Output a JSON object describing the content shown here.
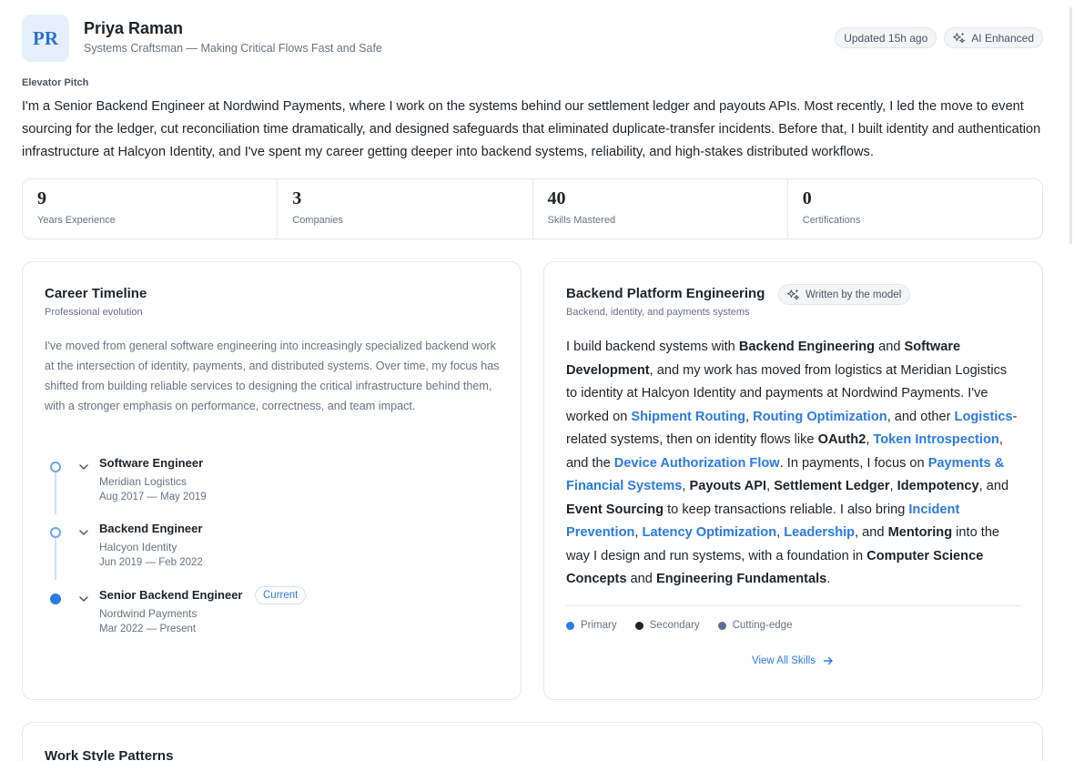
{
  "profile": {
    "initials": "PR",
    "name": "Priya Raman",
    "tagline": "Systems Craftsman — Making Critical Flows Fast and Safe",
    "updated": "Updated 15h ago",
    "ai_badge": "AI Enhanced"
  },
  "pitch": {
    "label": "Elevator Pitch",
    "text": "I'm a Senior Backend Engineer at Nordwind Payments, where I work on the systems behind our settlement ledger and payouts APIs. Most recently, I led the move to event sourcing for the ledger, cut reconciliation time dramatically, and designed safeguards that eliminated duplicate-transfer incidents. Before that, I built identity and authentication infrastructure at Halcyon Identity, and I've spent my career getting deeper into backend systems, reliability, and high-stakes distributed workflows."
  },
  "stats": [
    {
      "value": "9",
      "label": "Years Experience"
    },
    {
      "value": "3",
      "label": "Companies"
    },
    {
      "value": "40",
      "label": "Skills Mastered"
    },
    {
      "value": "0",
      "label": "Certifications"
    }
  ],
  "timeline": {
    "title": "Career Timeline",
    "subtitle": "Professional evolution",
    "intro": "I've moved from general software engineering into increasingly specialized backend work at the intersection of identity, payments, and distributed systems. Over time, my focus has shifted from building reliable services to designing the critical infrastructure behind them, with a stronger emphasis on performance, correctness, and team impact.",
    "items": [
      {
        "title": "Software Engineer",
        "company": "Meridian Logistics",
        "dates": "Aug 2017 — May 2019"
      },
      {
        "title": "Backend Engineer",
        "company": "Halcyon Identity",
        "dates": "Jun 2019 — Feb 2022"
      },
      {
        "title": "Senior Backend Engineer",
        "company": "Nordwind Payments",
        "dates": "Mar 2022 — Present",
        "badge": "Current"
      }
    ]
  },
  "skills": {
    "title": "Backend Platform Engineering",
    "model_badge": "Written by the model",
    "subtitle": "Backend, identity, and payments systems",
    "segments": [
      {
        "t": "text",
        "v": "I build backend systems with "
      },
      {
        "t": "bold",
        "v": "Backend Engineering"
      },
      {
        "t": "text",
        "v": " and "
      },
      {
        "t": "bold",
        "v": "Software Development"
      },
      {
        "t": "text",
        "v": ", and my work has moved from logistics at Meridian Logistics to identity at Halcyon Identity and payments at Nordwind Payments. I've worked on "
      },
      {
        "t": "link",
        "v": "Shipment Routing"
      },
      {
        "t": "text",
        "v": ", "
      },
      {
        "t": "link",
        "v": "Routing Optimization"
      },
      {
        "t": "text",
        "v": ", and other "
      },
      {
        "t": "link",
        "v": "Logistics"
      },
      {
        "t": "text",
        "v": "-related systems, then on identity flows like "
      },
      {
        "t": "bold",
        "v": "OAuth2"
      },
      {
        "t": "text",
        "v": ", "
      },
      {
        "t": "link",
        "v": "Token Introspection"
      },
      {
        "t": "text",
        "v": ", and the "
      },
      {
        "t": "link",
        "v": "Device Authorization Flow"
      },
      {
        "t": "text",
        "v": ". In payments, I focus on "
      },
      {
        "t": "link",
        "v": "Payments & Financial Systems"
      },
      {
        "t": "text",
        "v": ", "
      },
      {
        "t": "bold",
        "v": "Payouts API"
      },
      {
        "t": "text",
        "v": ", "
      },
      {
        "t": "bold",
        "v": "Settlement Ledger"
      },
      {
        "t": "text",
        "v": ", "
      },
      {
        "t": "bold",
        "v": "Idempotency"
      },
      {
        "t": "text",
        "v": ", and "
      },
      {
        "t": "bold",
        "v": "Event Sourcing"
      },
      {
        "t": "text",
        "v": " to keep transactions reliable. I also bring "
      },
      {
        "t": "link",
        "v": "Incident Prevention"
      },
      {
        "t": "text",
        "v": ", "
      },
      {
        "t": "link",
        "v": "Latency Optimization"
      },
      {
        "t": "text",
        "v": ", "
      },
      {
        "t": "link",
        "v": "Leadership"
      },
      {
        "t": "text",
        "v": ", and "
      },
      {
        "t": "bold",
        "v": "Mentoring"
      },
      {
        "t": "text",
        "v": " into the way I design and run systems, with a foundation in "
      },
      {
        "t": "bold",
        "v": "Computer Science Concepts"
      },
      {
        "t": "text",
        "v": " and "
      },
      {
        "t": "bold",
        "v": "Engineering Fundamentals"
      },
      {
        "t": "text",
        "v": "."
      }
    ],
    "legend": [
      {
        "label": "Primary",
        "color": "#2b7be4"
      },
      {
        "label": "Secondary",
        "color": "#1f2328"
      },
      {
        "label": "Cutting-edge",
        "color": "#5a6f9a"
      }
    ],
    "view_all": "View All Skills"
  },
  "work_style": {
    "title": "Work Style Patterns"
  },
  "colors": {
    "accent": "#2b7be4",
    "avatar_bg": "#e6f0fc"
  }
}
